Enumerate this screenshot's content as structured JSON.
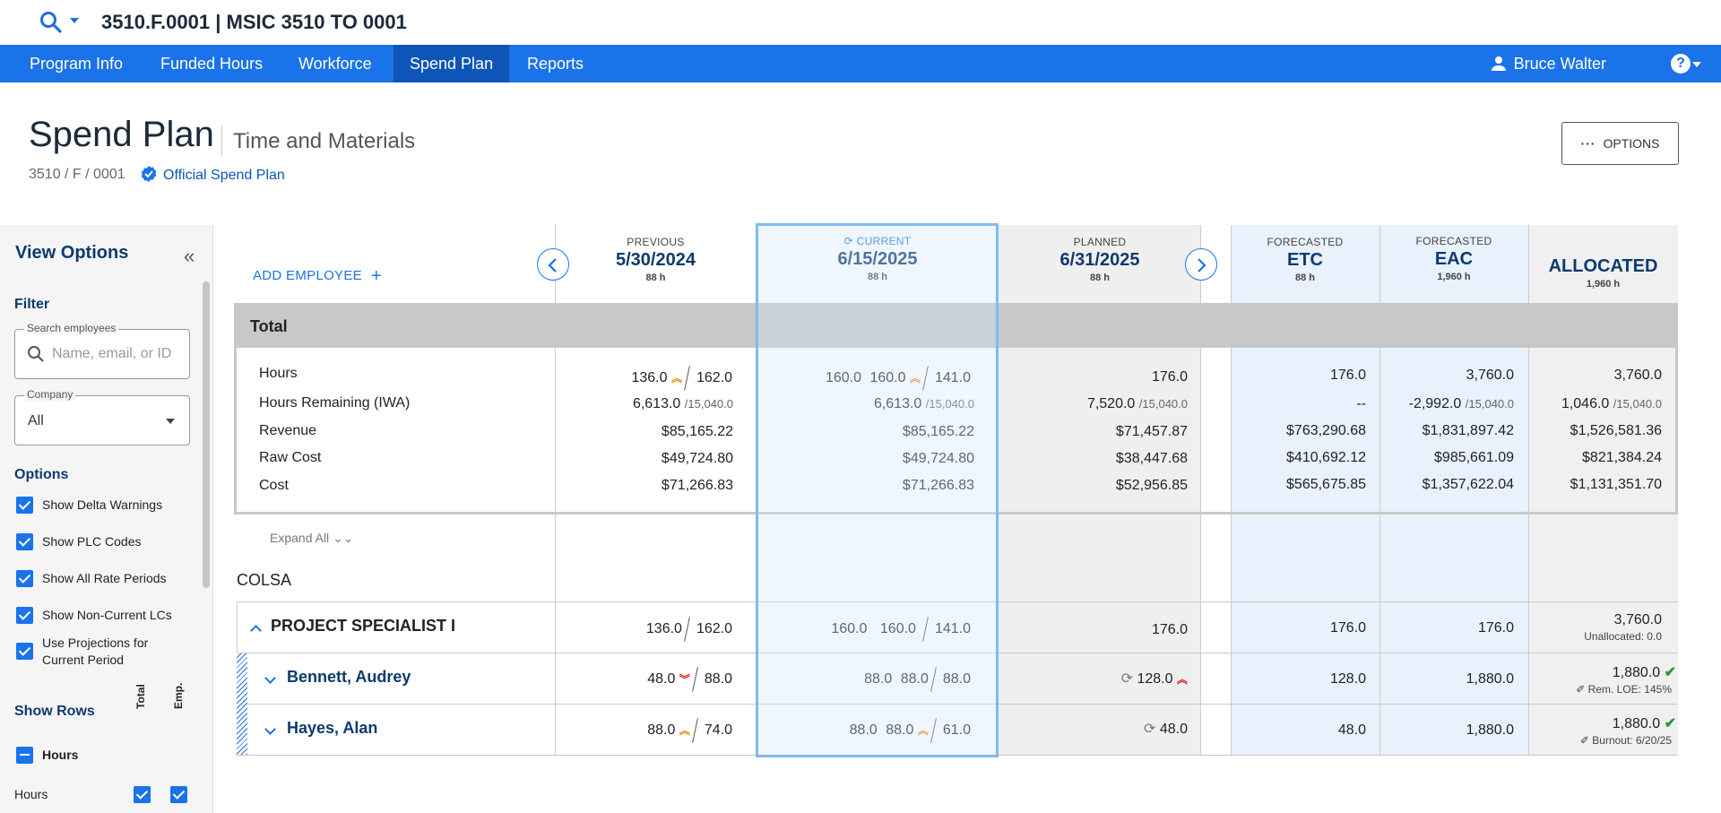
{
  "topbar": {
    "title": "3510.F.0001 | MSIC 3510 TO 0001"
  },
  "nav": {
    "items": [
      "Program Info",
      "Funded Hours",
      "Workforce",
      "Spend Plan",
      "Reports"
    ],
    "active": "Spend Plan",
    "user": "Bruce Walter",
    "help": "?"
  },
  "header": {
    "title": "Spend Plan",
    "subtitle": "Time and Materials",
    "breadcrumb": "3510 / F / 0001",
    "official_label": "Official Spend Plan",
    "options_label": "OPTIONS"
  },
  "sidebar": {
    "title": "View Options",
    "filter_heading": "Filter",
    "search_label": "Search employees",
    "search_placeholder": "Name, email, or ID",
    "company_label": "Company",
    "company_value": "All",
    "options_heading": "Options",
    "options": [
      {
        "label": "Show Delta Warnings",
        "checked": true
      },
      {
        "label": "Show PLC Codes",
        "checked": true
      },
      {
        "label": "Show All Rate Periods",
        "checked": true
      },
      {
        "label": "Show Non-Current LCs",
        "checked": true
      },
      {
        "label": "Use Projections for Current Period",
        "checked": true
      }
    ],
    "show_rows_heading": "Show Rows",
    "col_total": "Total",
    "col_emp": "Emp.",
    "group_label": "Hours",
    "row_hours_label": "Hours"
  },
  "grid": {
    "add_employee": "ADD EMPLOYEE",
    "expand_all": "Expand All",
    "columns": {
      "previous": {
        "label": "PREVIOUS",
        "date": "5/30/2024",
        "hours": "88 h"
      },
      "current": {
        "label": "CURRENT",
        "date": "6/15/2025",
        "hours": "88 h"
      },
      "planned": {
        "label": "PLANNED",
        "date": "6/31/2025",
        "hours": "88 h"
      },
      "etc": {
        "label": "FORECASTED",
        "title": "ETC",
        "hours": "88 h"
      },
      "eac": {
        "label": "FORECASTED",
        "title": "EAC",
        "hours": "1,960 h"
      },
      "allocated": {
        "title": "ALLOCATED",
        "hours": "1,960 h"
      }
    },
    "total": {
      "label": "Total",
      "rows": [
        {
          "label": "Hours",
          "prev_a": "136.0",
          "prev_b": "162.0",
          "cur_a": "160.0",
          "cur_b": "160.0",
          "cur_c": "141.0",
          "planned": "176.0",
          "etc": "176.0",
          "eac": "3,760.0",
          "alloc": "3,760.0"
        },
        {
          "label": "Hours Remaining (IWA)",
          "prev": "6,613.0",
          "prev_sub": "/15,040.0",
          "cur": "6,613.0",
          "cur_sub": "/15,040.0",
          "planned": "7,520.0",
          "planned_sub": "/15,040.0",
          "etc": "--",
          "eac": "-2,992.0",
          "eac_sub": "/15,040.0",
          "alloc": "1,046.0",
          "alloc_sub": "/15,040.0"
        },
        {
          "label": "Revenue",
          "prev": "$85,165.22",
          "cur": "$85,165.22",
          "planned": "$71,457.87",
          "etc": "$763,290.68",
          "eac": "$1,831,897.42",
          "alloc": "$1,526,581.36"
        },
        {
          "label": "Raw Cost",
          "prev": "$49,724.80",
          "cur": "$49,724.80",
          "planned": "$38,447.68",
          "etc": "$410,692.12",
          "eac": "$985,661.09",
          "alloc": "$821,384.24"
        },
        {
          "label": "Cost",
          "prev": "$71,266.83",
          "cur": "$71,266.83",
          "planned": "$52,956.85",
          "etc": "$565,675.85",
          "eac": "$1,357,622.04",
          "alloc": "$1,131,351.70"
        }
      ]
    },
    "company": "COLSA",
    "group": {
      "name": "PROJECT SPECIALIST I",
      "prev_a": "136.0",
      "prev_b": "162.0",
      "cur_a": "160.0",
      "cur_b": "160.0",
      "cur_c": "141.0",
      "planned": "176.0",
      "etc": "176.0",
      "eac": "176.0",
      "alloc": "3,760.0",
      "alloc_note": "Unallocated: 0.0"
    },
    "employees": [
      {
        "name": "Bennett, Audrey",
        "prev_a": "48.0",
        "prev_b": "88.0",
        "cur_a": "88.0",
        "cur_b": "88.0",
        "cur_c": "88.0",
        "planned": "128.0",
        "etc": "128.0",
        "eac": "1,880.0",
        "alloc": "1,880.0",
        "alloc_note": "Rem. LOE: 145%"
      },
      {
        "name": "Hayes, Alan",
        "prev_a": "88.0",
        "prev_b": "74.0",
        "cur_a": "88.0",
        "cur_b": "88.0",
        "cur_c": "61.0",
        "planned": "48.0",
        "etc": "48.0",
        "eac": "1,880.0",
        "alloc": "1,880.0",
        "alloc_note": "Burnout: 6/20/25"
      }
    ]
  },
  "colors": {
    "primary": "#1a73e8",
    "nav_active": "#0d56b8",
    "current_border": "#7fbbf0",
    "forecast_bg": "#e8f1fc",
    "planned_bg": "#efefef"
  }
}
